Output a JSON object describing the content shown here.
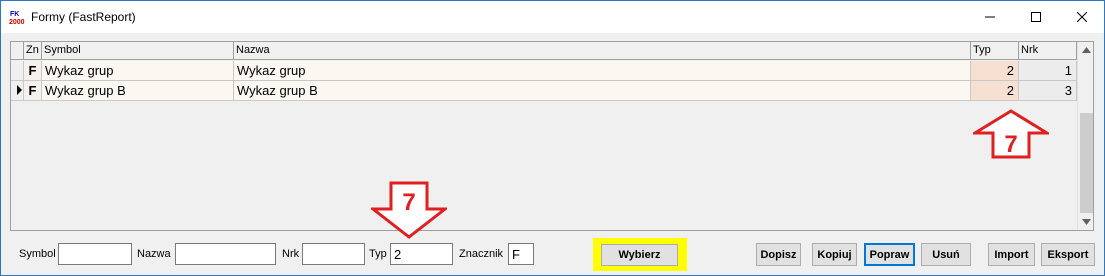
{
  "window": {
    "title": "Formy  (FastReport)",
    "app_icon": "fk-2000-app-icon"
  },
  "grid": {
    "columns": [
      {
        "key": "zn",
        "label": "Zn"
      },
      {
        "key": "symbol",
        "label": "Symbol"
      },
      {
        "key": "nazwa",
        "label": "Nazwa"
      },
      {
        "key": "typ",
        "label": "Typ"
      },
      {
        "key": "nrk",
        "label": "Nrk"
      }
    ],
    "rows": [
      {
        "zn": "F",
        "symbol": "Wykaz grup",
        "nazwa": "Wykaz grup",
        "typ": "2",
        "nrk": "1",
        "current": false
      },
      {
        "zn": "F",
        "symbol": "Wykaz grup B",
        "nazwa": "Wykaz grup B",
        "typ": "2",
        "nrk": "3",
        "current": true
      }
    ]
  },
  "filters": {
    "symbol_label": "Symbol",
    "symbol_value": "",
    "nazwa_label": "Nazwa",
    "nazwa_value": "",
    "nrk_label": "Nrk",
    "nrk_value": "",
    "typ_label": "Typ",
    "typ_value": "2",
    "znacznik_label": "Znacznik",
    "znacznik_value": "F"
  },
  "buttons": {
    "wybierz": "Wybierz",
    "dopisz": "Dopisz",
    "kopiuj": "Kopiuj",
    "popraw": "Popraw",
    "usun": "Usuń",
    "import": "Import",
    "eksport": "Eksport"
  },
  "annotations": {
    "grid_marker": "7",
    "filter_marker": "7",
    "marker_color": "#e02020",
    "highlight_color": "#ffff00"
  }
}
